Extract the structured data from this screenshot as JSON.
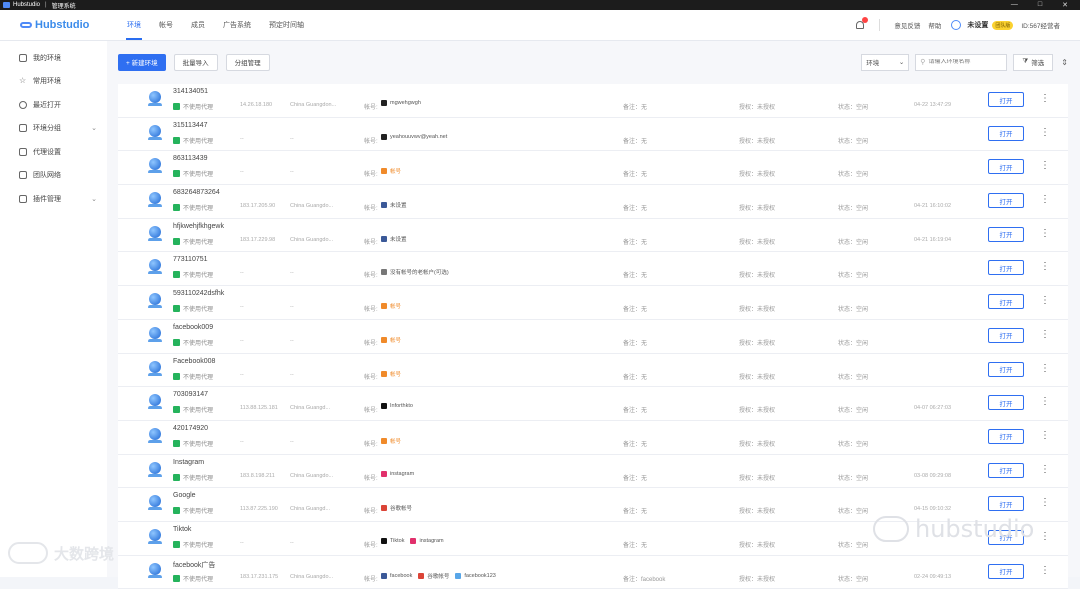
{
  "titlebar": {
    "app_name": "Hubstudio",
    "separator": "|",
    "window_title": "管理系统",
    "controls": [
      "—",
      "□",
      "✕"
    ]
  },
  "brand": {
    "name": "Hubstudio"
  },
  "nav": {
    "tabs": [
      "环境",
      "帐号",
      "成员",
      "广告系统",
      "预定时间轴"
    ]
  },
  "topright": {
    "link1": "意见反馈",
    "link2": "帮助",
    "user_name": "未设置",
    "user_badge": "团队版",
    "user_id": "ID:567经营者"
  },
  "sidebar": {
    "items": [
      {
        "label": "我的环境",
        "chevron": ""
      },
      {
        "label": "常用环境",
        "chevron": ""
      },
      {
        "label": "最近打开",
        "chevron": ""
      },
      {
        "label": "环境分组",
        "chevron": "⌄"
      },
      {
        "label": "代理设置",
        "chevron": ""
      },
      {
        "label": "团队网络",
        "chevron": ""
      },
      {
        "label": "插件管理",
        "chevron": "⌄"
      }
    ]
  },
  "toolbar": {
    "new_env": "+ 新建环境",
    "batch_import": "批量导入",
    "group_manage": "分组管理",
    "select_value": "环境",
    "search_placeholder": "请输入环境名称",
    "filter": "筛选",
    "filter_icon": "filter-icon"
  },
  "row_labels": {
    "account": "帐号:",
    "open": "打开"
  },
  "rows": [
    {
      "name": "314134051",
      "proxy": "不使用代理",
      "ip": "14.26.18.180",
      "region": "China Guangdon...",
      "accounts": [
        {
          "text": "mgwehgwgh",
          "color": "#222",
          "warn": false
        }
      ],
      "remark": "备注：无",
      "auth": "授权：未授权",
      "status": "状态：空闲",
      "time": "04-22 13:47:29"
    },
    {
      "name": "315113447",
      "proxy": "不使用代理",
      "ip": "--",
      "region": "--",
      "accounts": [
        {
          "text": "yeahouuvwv@yeah.net",
          "color": "#222",
          "warn": false
        }
      ],
      "remark": "备注：无",
      "auth": "授权：未授权",
      "status": "状态：空闲",
      "time": ""
    },
    {
      "name": "863113439",
      "proxy": "不使用代理",
      "ip": "--",
      "region": "--",
      "accounts": [
        {
          "text": "帐号",
          "color": "#f08a2a",
          "warn": true
        }
      ],
      "remark": "备注：无",
      "auth": "授权：未授权",
      "status": "状态：空闲",
      "time": ""
    },
    {
      "name": "683264873264",
      "proxy": "不使用代理",
      "ip": "183.17.205.90",
      "region": "China Guangdo...",
      "accounts": [
        {
          "text": "未设置",
          "color": "#3b5998",
          "warn": false
        }
      ],
      "remark": "备注：无",
      "auth": "授权：未授权",
      "status": "状态：空闲",
      "time": "04-21 16:10:02"
    },
    {
      "name": "hfjkwehjfkhgewk",
      "proxy": "不使用代理",
      "ip": "183.17.229.98",
      "region": "China Guangdo...",
      "accounts": [
        {
          "text": "未设置",
          "color": "#3b5998",
          "warn": false
        }
      ],
      "remark": "备注：无",
      "auth": "授权：未授权",
      "status": "状态：空闲",
      "time": "04-21 16:19:04"
    },
    {
      "name": "773110751",
      "proxy": "不使用代理",
      "ip": "--",
      "region": "--",
      "accounts": [
        {
          "text": "没有帐号的老帐户(可选)",
          "color": "#777",
          "warn": false
        }
      ],
      "remark": "备注：无",
      "auth": "授权：未授权",
      "status": "状态：空闲",
      "time": ""
    },
    {
      "name": "593110242dsfhk",
      "proxy": "不使用代理",
      "ip": "--",
      "region": "--",
      "accounts": [
        {
          "text": "帐号",
          "color": "#f08a2a",
          "warn": true
        }
      ],
      "remark": "备注：无",
      "auth": "授权：未授权",
      "status": "状态：空闲",
      "time": ""
    },
    {
      "name": "facebook009",
      "proxy": "不使用代理",
      "ip": "--",
      "region": "--",
      "accounts": [
        {
          "text": "帐号",
          "color": "#f08a2a",
          "warn": true
        }
      ],
      "remark": "备注：无",
      "auth": "授权：未授权",
      "status": "状态：空闲",
      "time": ""
    },
    {
      "name": "Facebook008",
      "proxy": "不使用代理",
      "ip": "--",
      "region": "--",
      "accounts": [
        {
          "text": "帐号",
          "color": "#f08a2a",
          "warn": true
        }
      ],
      "remark": "备注：无",
      "auth": "授权：未授权",
      "status": "状态：空闲",
      "time": ""
    },
    {
      "name": "703093147",
      "proxy": "不使用代理",
      "ip": "113.88.125.181",
      "region": "China Guangd...",
      "accounts": [
        {
          "text": "Inforthkto",
          "color": "#111",
          "warn": false
        }
      ],
      "remark": "备注：无",
      "auth": "授权：未授权",
      "status": "状态：空闲",
      "time": "04-07 06:27:03"
    },
    {
      "name": "420174920",
      "proxy": "不使用代理",
      "ip": "--",
      "region": "--",
      "accounts": [
        {
          "text": "帐号",
          "color": "#f08a2a",
          "warn": true
        }
      ],
      "remark": "备注：无",
      "auth": "授权：未授权",
      "status": "状态：空闲",
      "time": ""
    },
    {
      "name": "Instagram",
      "proxy": "不使用代理",
      "ip": "183.8.198.211",
      "region": "China Guangdo...",
      "accounts": [
        {
          "text": "instagram",
          "color": "#e1306c",
          "warn": false
        }
      ],
      "remark": "备注：无",
      "auth": "授权：未授权",
      "status": "状态：空闲",
      "time": "03-08 09:29:08"
    },
    {
      "name": "Google",
      "proxy": "不使用代理",
      "ip": "113.87.225.190",
      "region": "China Guangd...",
      "accounts": [
        {
          "text": "谷歌帐号",
          "color": "#db4437",
          "warn": false
        }
      ],
      "remark": "备注：无",
      "auth": "授权：未授权",
      "status": "状态：空闲",
      "time": "04-15 09:10:32"
    },
    {
      "name": "Tiktok",
      "proxy": "不使用代理",
      "ip": "--",
      "region": "--",
      "accounts": [
        {
          "text": "Tiktok",
          "color": "#111",
          "warn": false
        },
        {
          "text": "instagram",
          "color": "#e1306c",
          "warn": false
        }
      ],
      "remark": "备注：无",
      "auth": "授权：未授权",
      "status": "状态：空闲",
      "time": ""
    },
    {
      "name": "facebook广告",
      "proxy": "不使用代理",
      "ip": "183.17.231.175",
      "region": "China Guangdo...",
      "accounts": [
        {
          "text": "facebook",
          "color": "#3b5998",
          "warn": false
        },
        {
          "text": "谷歌帐号",
          "color": "#db4437",
          "warn": false
        },
        {
          "text": "facebook123",
          "color": "#58a6e8",
          "warn": false
        }
      ],
      "remark": "备注：facebook",
      "auth": "授权：未授权",
      "status": "状态：空闲",
      "time": "02-24 09:49:13"
    }
  ],
  "watermarks": {
    "left": "大数跨境",
    "right": "hubstudio"
  }
}
